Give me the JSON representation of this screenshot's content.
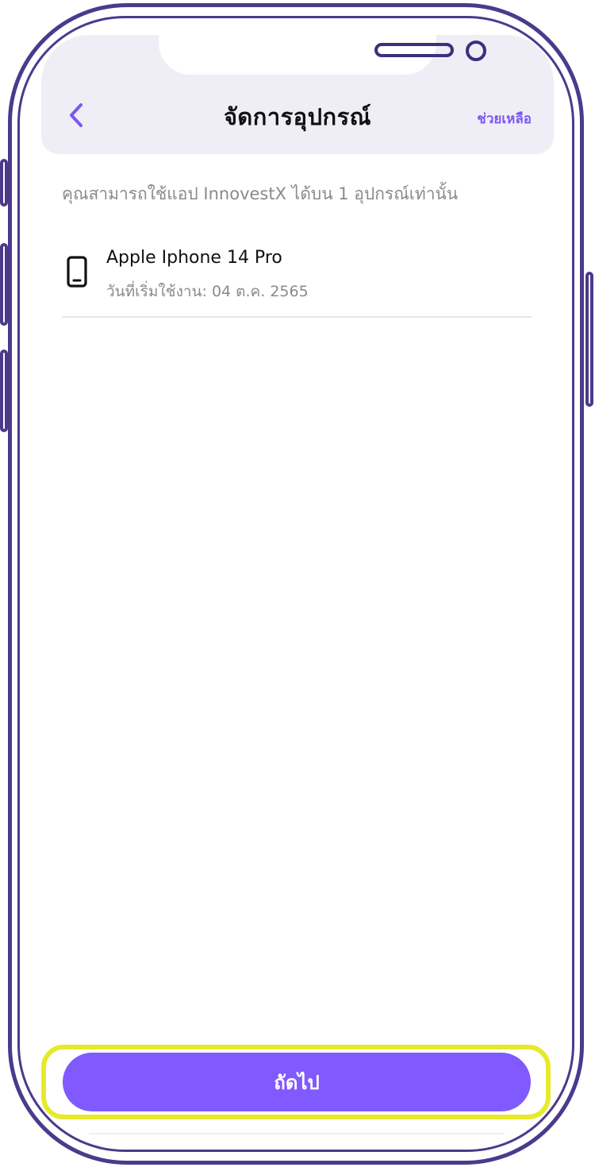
{
  "header": {
    "title": "จัดการอุปกรณ์",
    "help_label": "ช่วยเหลือ",
    "back_icon": "chevron-left-icon"
  },
  "info_text": "คุณสามารถใช้แอป InnovestX ได้บน 1 อุปกรณ์เท่านั้น",
  "devices": [
    {
      "icon": "smartphone-icon",
      "name": "Apple Iphone 14 Pro",
      "start_date": "วันที่เริ่มใช้งาน: 04 ต.ค. 2565"
    }
  ],
  "footer": {
    "next_label": "ถัดไป"
  },
  "colors": {
    "accent": "#8059ff",
    "header_bg": "#efeef7",
    "frame": "#4b3a8c",
    "highlight": "#e7e92a"
  }
}
